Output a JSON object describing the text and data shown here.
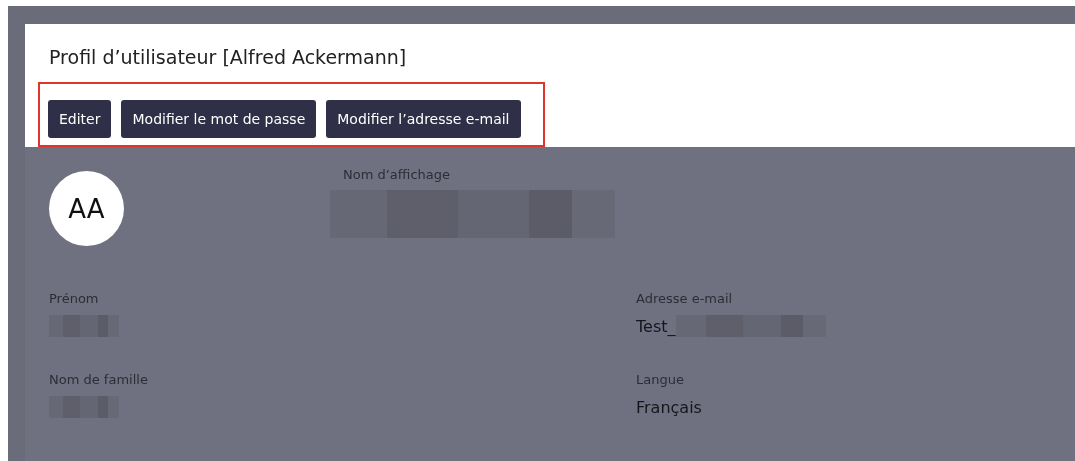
{
  "window": {
    "title": "Profil d’utilisateur [Alfred Ackermann]"
  },
  "buttons": [
    "Editer",
    "Modifier le mot de passe",
    "Modifier l’adresse e-mail"
  ],
  "highlight": {
    "on": true
  },
  "avatar": {
    "initials": "AA"
  },
  "display_name": {
    "label": "Nom d’affichage",
    "redacted": true
  },
  "fields": [
    {
      "label": "Prénom",
      "redacted": true
    },
    {
      "label": "Adresse e-mail",
      "value": "Test_",
      "redacted": true
    },
    {
      "label": "Nom de famille",
      "redacted": true
    },
    {
      "label": "Langue",
      "value": "Français",
      "redacted": false
    }
  ]
}
